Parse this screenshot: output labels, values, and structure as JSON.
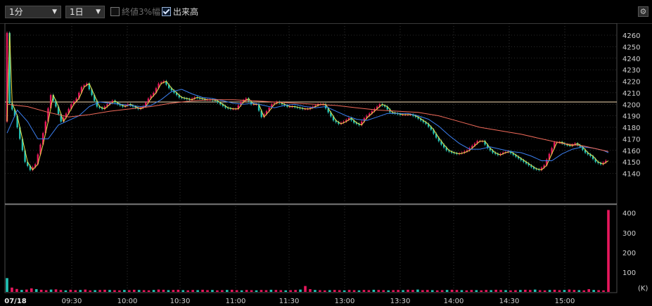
{
  "toolbar": {
    "interval_select": "1分",
    "period_select": "1日",
    "range_3pct_label": "終値3%幅",
    "range_3pct_checked": false,
    "volume_label": "出来高",
    "volume_checked": true,
    "settings_icon": "gear-icon"
  },
  "colors": {
    "up": "#e8175d",
    "down": "#22c4b6",
    "ma_short": "#e8e14a",
    "ma_mid": "#3b7ff0",
    "ma_long": "#f06a5a",
    "ref_line": "#f3d9b0",
    "grid": "#555555"
  },
  "chart_data": [
    {
      "type": "line",
      "subtype": "candlestick-intraday",
      "date": "07/18",
      "x_tick_labels": [
        "07/18",
        "09:30",
        "10:00",
        "10:30",
        "11:00",
        "11:30",
        "13:00",
        "13:30",
        "14:00",
        "14:30",
        "15:00"
      ],
      "y_tick_labels": [
        "4260",
        "4250",
        "4240",
        "4230",
        "4220",
        "4210",
        "4200",
        "4190",
        "4180",
        "4170",
        "4160",
        "4150",
        "4140"
      ],
      "ylim": [
        4135,
        4265
      ],
      "reference_line": 4202,
      "series": [
        {
          "values": [
            [
              0,
              4185
            ],
            [
              1,
              4262
            ],
            [
              2,
              4201
            ],
            [
              4,
              4190
            ],
            [
              6,
              4170
            ],
            [
              8,
              4150
            ],
            [
              10,
              4143
            ],
            [
              12,
              4148
            ],
            [
              14,
              4165
            ],
            [
              16,
              4185
            ],
            [
              18,
              4208
            ],
            [
              20,
              4198
            ],
            [
              22,
              4185
            ],
            [
              24,
              4192
            ],
            [
              26,
              4200
            ],
            [
              28,
              4205
            ],
            [
              30,
              4215
            ],
            [
              32,
              4218
            ],
            [
              34,
              4208
            ],
            [
              36,
              4198
            ],
            [
              38,
              4196
            ],
            [
              40,
              4200
            ],
            [
              42,
              4203
            ],
            [
              44,
              4200
            ],
            [
              46,
              4198
            ],
            [
              48,
              4200
            ],
            [
              50,
              4198
            ],
            [
              52,
              4196
            ],
            [
              54,
              4198
            ],
            [
              56,
              4205
            ],
            [
              58,
              4210
            ],
            [
              60,
              4218
            ],
            [
              62,
              4220
            ],
            [
              64,
              4214
            ],
            [
              66,
              4210
            ],
            [
              68,
              4206
            ],
            [
              70,
              4205
            ],
            [
              72,
              4204
            ],
            [
              74,
              4206
            ],
            [
              76,
              4205
            ],
            [
              78,
              4204
            ],
            [
              80,
              4204
            ],
            [
              82,
              4203
            ],
            [
              84,
              4200
            ],
            [
              86,
              4197
            ],
            [
              88,
              4196
            ],
            [
              90,
              4196
            ],
            [
              92,
              4202
            ],
            [
              94,
              4205
            ],
            [
              96,
              4200
            ],
            [
              98,
              4200
            ],
            [
              100,
              4189
            ],
            [
              102,
              4194
            ],
            [
              104,
              4200
            ],
            [
              106,
              4202
            ],
            [
              108,
              4200
            ],
            [
              110,
              4198
            ],
            [
              112,
              4198
            ],
            [
              114,
              4197
            ],
            [
              116,
              4196
            ],
            [
              118,
              4196
            ],
            [
              120,
              4198
            ],
            [
              122,
              4200
            ],
            [
              124,
              4200
            ],
            [
              126,
              4193
            ],
            [
              128,
              4186
            ],
            [
              130,
              4183
            ],
            [
              132,
              4185
            ],
            [
              134,
              4188
            ],
            [
              136,
              4184
            ],
            [
              138,
              4182
            ],
            [
              140,
              4188
            ],
            [
              142,
              4192
            ],
            [
              144,
              4196
            ],
            [
              146,
              4200
            ],
            [
              148,
              4198
            ],
            [
              150,
              4193
            ],
            [
              152,
              4192
            ],
            [
              154,
              4191
            ],
            [
              156,
              4191
            ],
            [
              158,
              4191
            ],
            [
              160,
              4189
            ],
            [
              162,
              4186
            ],
            [
              164,
              4183
            ],
            [
              166,
              4178
            ],
            [
              168,
              4171
            ],
            [
              170,
              4165
            ],
            [
              172,
              4160
            ],
            [
              174,
              4158
            ],
            [
              176,
              4157
            ],
            [
              178,
              4158
            ],
            [
              180,
              4160
            ],
            [
              182,
              4164
            ],
            [
              184,
              4168
            ],
            [
              186,
              4168
            ],
            [
              188,
              4162
            ],
            [
              190,
              4158
            ],
            [
              192,
              4156
            ],
            [
              194,
              4158
            ],
            [
              196,
              4159
            ],
            [
              198,
              4156
            ],
            [
              200,
              4153
            ],
            [
              202,
              4150
            ],
            [
              204,
              4147
            ],
            [
              206,
              4144
            ],
            [
              208,
              4143
            ],
            [
              210,
              4147
            ],
            [
              212,
              4157
            ],
            [
              214,
              4167
            ],
            [
              216,
              4167
            ],
            [
              218,
              4165
            ],
            [
              220,
              4164
            ],
            [
              222,
              4166
            ],
            [
              224,
              4163
            ],
            [
              226,
              4158
            ],
            [
              228,
              4155
            ],
            [
              230,
              4150
            ],
            [
              232,
              4148
            ],
            [
              234,
              4151
            ]
          ]
        },
        {
          "values": [
            [
              0,
              4175
            ],
            [
              4,
              4195
            ],
            [
              8,
              4185
            ],
            [
              12,
              4170
            ],
            [
              16,
              4170
            ],
            [
              20,
              4182
            ],
            [
              24,
              4186
            ],
            [
              28,
              4190
            ],
            [
              32,
              4198
            ],
            [
              36,
              4202
            ],
            [
              40,
              4201
            ],
            [
              44,
              4200
            ],
            [
              48,
              4199
            ],
            [
              52,
              4198
            ],
            [
              56,
              4199
            ],
            [
              60,
              4204
            ],
            [
              64,
              4211
            ],
            [
              68,
              4213
            ],
            [
              72,
              4209
            ],
            [
              76,
              4206
            ],
            [
              80,
              4205
            ],
            [
              84,
              4203
            ],
            [
              88,
              4201
            ],
            [
              92,
              4200
            ],
            [
              96,
              4201
            ],
            [
              100,
              4199
            ],
            [
              104,
              4197
            ],
            [
              108,
              4199
            ],
            [
              112,
              4200
            ],
            [
              116,
              4198
            ],
            [
              120,
              4197
            ],
            [
              124,
              4198
            ],
            [
              128,
              4194
            ],
            [
              132,
              4190
            ],
            [
              136,
              4187
            ],
            [
              140,
              4186
            ],
            [
              144,
              4189
            ],
            [
              148,
              4192
            ],
            [
              152,
              4192
            ],
            [
              156,
              4192
            ],
            [
              160,
              4190
            ],
            [
              164,
              4187
            ],
            [
              168,
              4181
            ],
            [
              172,
              4173
            ],
            [
              176,
              4166
            ],
            [
              180,
              4161
            ],
            [
              184,
              4161
            ],
            [
              188,
              4163
            ],
            [
              192,
              4161
            ],
            [
              196,
              4159
            ],
            [
              200,
              4158
            ],
            [
              204,
              4155
            ],
            [
              208,
              4151
            ],
            [
              212,
              4151
            ],
            [
              216,
              4157
            ],
            [
              220,
              4161
            ],
            [
              224,
              4163
            ],
            [
              228,
              4162
            ],
            [
              232,
              4160
            ],
            [
              234,
              4158
            ]
          ]
        },
        {
          "values": [
            [
              0,
              4200
            ],
            [
              8,
              4198
            ],
            [
              16,
              4193
            ],
            [
              24,
              4189
            ],
            [
              32,
              4191
            ],
            [
              40,
              4194
            ],
            [
              48,
              4196
            ],
            [
              56,
              4198
            ],
            [
              64,
              4201
            ],
            [
              72,
              4203
            ],
            [
              80,
              4204
            ],
            [
              88,
              4204
            ],
            [
              96,
              4203
            ],
            [
              104,
              4202
            ],
            [
              112,
              4201
            ],
            [
              120,
              4200
            ],
            [
              128,
              4199
            ],
            [
              136,
              4197
            ],
            [
              144,
              4195
            ],
            [
              152,
              4194
            ],
            [
              160,
              4193
            ],
            [
              168,
              4190
            ],
            [
              176,
              4185
            ],
            [
              184,
              4180
            ],
            [
              192,
              4177
            ],
            [
              200,
              4174
            ],
            [
              208,
              4170
            ],
            [
              216,
              4166
            ],
            [
              224,
              4164
            ],
            [
              232,
              4160
            ],
            [
              234,
              4159
            ]
          ]
        }
      ]
    },
    {
      "type": "bar",
      "y_tick_labels": [
        "400",
        "300",
        "200",
        "100"
      ],
      "unit_label": "(K)",
      "ylim": [
        0,
        430
      ],
      "values": [
        70,
        22,
        15,
        10,
        12,
        18,
        14,
        11,
        9,
        12,
        13,
        10,
        8,
        11,
        9,
        10,
        12,
        8,
        9,
        10,
        11,
        10,
        9,
        8,
        10,
        9,
        11,
        10,
        9,
        8,
        10,
        12,
        11,
        9,
        10,
        11,
        9,
        8,
        10,
        9,
        11,
        9,
        10,
        8,
        9,
        10,
        11,
        9,
        8,
        10,
        9,
        8,
        10,
        9,
        11,
        10,
        9,
        8,
        9,
        10,
        12,
        30,
        14,
        10,
        9,
        8,
        9,
        10,
        9,
        8,
        10,
        9,
        8,
        10,
        9,
        11,
        10,
        9,
        8,
        9,
        10,
        9,
        11,
        10,
        12,
        9,
        10,
        9,
        8,
        9,
        10,
        11,
        10,
        9,
        8,
        10,
        9,
        8,
        10,
        9,
        11,
        10,
        9,
        8,
        9,
        10,
        11,
        10,
        12,
        9,
        8,
        10,
        11,
        9,
        10,
        12,
        10,
        9,
        8,
        14,
        10,
        9,
        8,
        415
      ]
    }
  ]
}
